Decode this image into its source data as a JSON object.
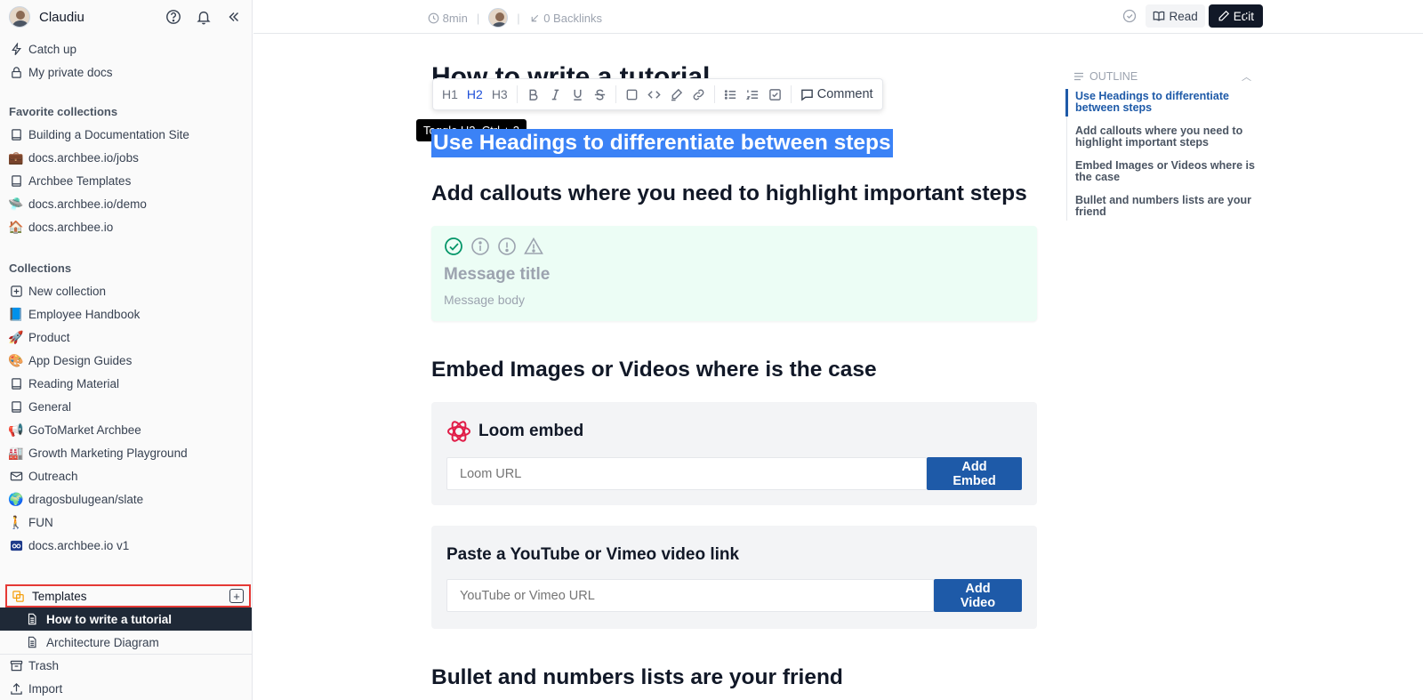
{
  "sidebar": {
    "user_name": "Claudiu",
    "top_items": [
      {
        "label": "Catch up",
        "icon": "lightning-icon"
      },
      {
        "label": "My private docs",
        "icon": "lock-icon"
      }
    ],
    "favorites_heading": "Favorite collections",
    "favorites": [
      {
        "label": "Building a Documentation Site",
        "icon": "book-icon"
      },
      {
        "label": "docs.archbee.io/jobs",
        "icon": "briefcase-icon"
      },
      {
        "label": "Archbee Templates",
        "icon": "book-icon"
      },
      {
        "label": "docs.archbee.io/demo",
        "icon": "ufo-icon"
      },
      {
        "label": "docs.archbee.io",
        "icon": "house-icon"
      }
    ],
    "collections_heading": "Collections",
    "collections": [
      {
        "label": "New collection",
        "icon": "plus-square-icon"
      },
      {
        "label": "Employee Handbook",
        "icon": "blue-book-icon"
      },
      {
        "label": "Product",
        "icon": "rocket-icon"
      },
      {
        "label": "App Design Guides",
        "icon": "palette-icon"
      },
      {
        "label": "Reading Material",
        "icon": "book-icon"
      },
      {
        "label": "General",
        "icon": "book-icon"
      },
      {
        "label": "GoToMarket Archbee",
        "icon": "megaphone-icon"
      },
      {
        "label": "Growth Marketing Playground",
        "icon": "factory-icon"
      },
      {
        "label": "Outreach",
        "icon": "envelope-icon"
      },
      {
        "label": "dragosbulugean/slate",
        "icon": "globe-icon"
      },
      {
        "label": "FUN",
        "icon": "person-walking-icon"
      },
      {
        "label": "docs.archbee.io v1",
        "icon": "ab-badge-icon"
      }
    ],
    "templates_label": "Templates",
    "template_docs": [
      {
        "label": "How to write a tutorial",
        "active": true
      },
      {
        "label": "Architecture Diagram",
        "active": false
      }
    ],
    "trash_label": "Trash",
    "import_label": "Import"
  },
  "topbar": {
    "read_time": "8min",
    "backlinks": "0 Backlinks",
    "read_label": "Read",
    "edit_label": "Edit"
  },
  "editor": {
    "doc_title": "How to write a tutorial",
    "toolbar": {
      "h1": "H1",
      "h2": "H2",
      "h3": "H3",
      "comment": "Comment"
    },
    "tooltip": "Toggle H2. Ctrl + 2",
    "selected_heading": "Use Headings to differentiate between steps",
    "heading_callouts": "Add callouts where you need to highlight important steps",
    "callout": {
      "title": "Message title",
      "body": "Message body"
    },
    "heading_embed": "Embed Images or Videos where is the case",
    "loom": {
      "title": "Loom embed",
      "placeholder": "Loom URL",
      "button": "Add Embed"
    },
    "video": {
      "title": "Paste a YouTube or Vimeo video link",
      "placeholder": "YouTube or Vimeo URL",
      "button": "Add Video"
    },
    "heading_lists": "Bullet and numbers lists are your friend"
  },
  "outline": {
    "heading": "OUTLINE",
    "items": [
      "Use Headings to differentiate between steps",
      "Add callouts where you need to highlight important steps",
      "Embed Images or Videos where is the case",
      "Bullet and numbers lists are your friend"
    ]
  },
  "colors": {
    "accent": "#1e5aa8",
    "selection": "#3b82f6",
    "callout_bg": "#ecfdf5",
    "highlight_border": "#e53935"
  }
}
